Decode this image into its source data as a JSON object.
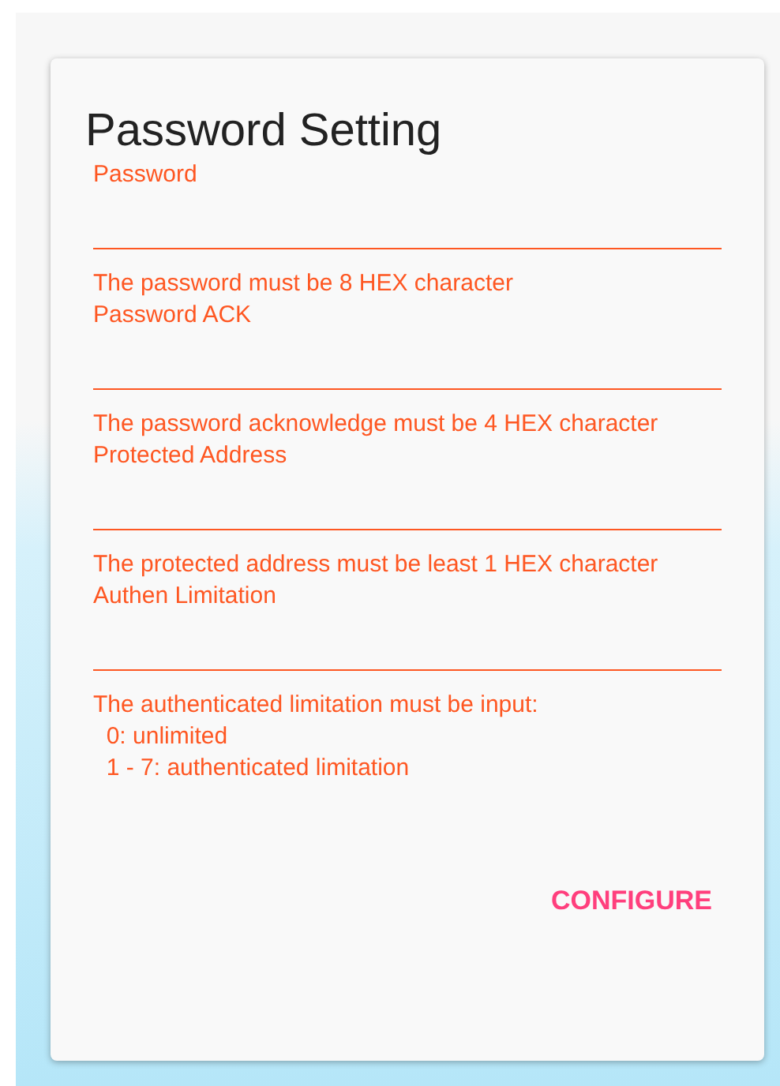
{
  "dialog": {
    "title": "Password Setting",
    "fields": [
      {
        "label": "Password",
        "error": "The password must be 8 HEX character"
      },
      {
        "label": "Password ACK",
        "error": "The password acknowledge must be 4 HEX character"
      },
      {
        "label": "Protected Address",
        "error": "The protected address must be least 1 HEX character"
      },
      {
        "label": "Authen Limitation",
        "error": "The authenticated limitation must be input:\n  0: unlimited\n  1 - 7: authenticated limitation"
      }
    ],
    "button": "CONFIGURE"
  }
}
